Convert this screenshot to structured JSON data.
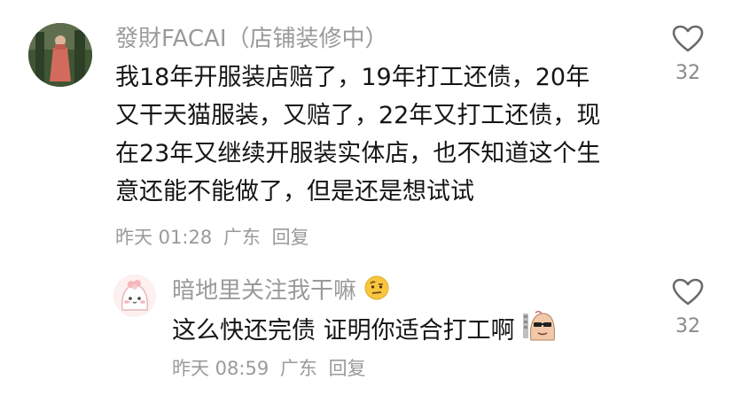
{
  "comments": [
    {
      "username": "發財FACAI（店铺装修中）",
      "lines": [
        "我18年开服装店赔了，19年打工还债，20年",
        "又干天猫服装，又赔了，22年又打工还债，现",
        "在23年又继续开服装实体店，也不知道这个生",
        "意还能不能做了，但是还是想试试"
      ],
      "time": "昨天 01:28",
      "location": "广东",
      "reply_label": "回复",
      "likes": "32"
    },
    {
      "username": "暗地里关注我干嘛",
      "username_emoji": "raised-eyebrow-emoji",
      "text": "这么快还完债 证明你适合打工啊",
      "text_sticker": "sticker-icon",
      "time": "昨天 08:59",
      "location": "广东",
      "reply_label": "回复",
      "likes": "32"
    }
  ]
}
